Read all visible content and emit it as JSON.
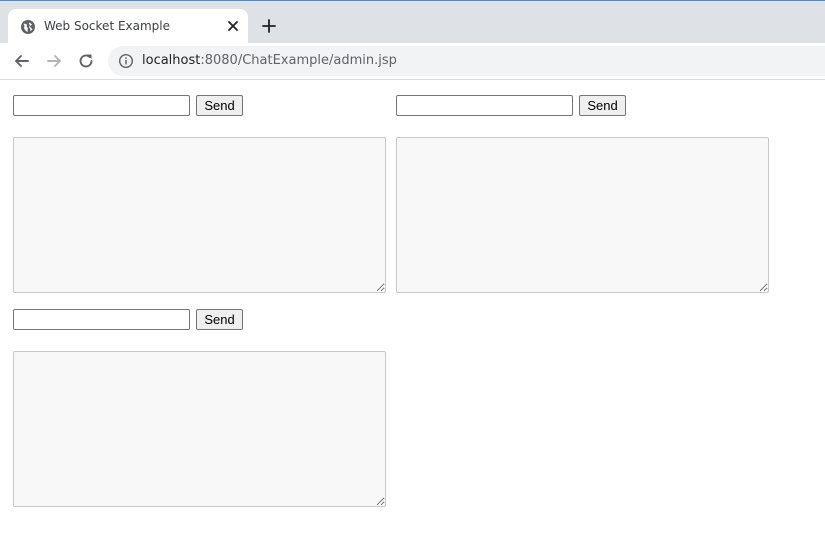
{
  "browser": {
    "tab": {
      "title": "Web Socket Example",
      "favicon": "globe-icon"
    },
    "address_bar": {
      "host": "localhost",
      "path": ":8080/ChatExample/admin.jsp"
    }
  },
  "page": {
    "panels": [
      {
        "message_value": "",
        "send_label": "Send",
        "log": ""
      },
      {
        "message_value": "",
        "send_label": "Send",
        "log": ""
      },
      {
        "message_value": "",
        "send_label": "Send",
        "log": ""
      }
    ]
  },
  "colors": {
    "tabstrip": "#dee1e6",
    "omnibox": "#f1f3f4",
    "textarea_bg": "#f8f8f8"
  }
}
